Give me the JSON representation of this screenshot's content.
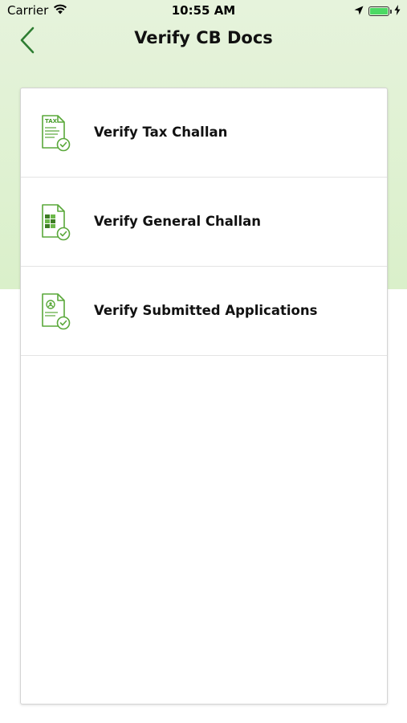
{
  "status_bar": {
    "carrier": "Carrier",
    "time": "10:55 AM",
    "battery_level": 1.0,
    "wifi_icon": "wifi-icon",
    "location_icon": "location-arrow-icon",
    "charging_icon": "bolt-icon"
  },
  "nav": {
    "title": "Verify CB Docs",
    "back_icon": "chevron-left-icon"
  },
  "menu": {
    "items": [
      {
        "label": "Verify Tax Challan",
        "icon": "tax-document-check-icon",
        "icon_text": "TAX"
      },
      {
        "label": "Verify General Challan",
        "icon": "general-document-check-icon"
      },
      {
        "label": "Verify Submitted Applications",
        "icon": "application-document-check-icon"
      }
    ]
  },
  "colors": {
    "accent": "#4a9d2e",
    "header_bg": "#e2f2d6",
    "back_arrow": "#2e7d32"
  }
}
